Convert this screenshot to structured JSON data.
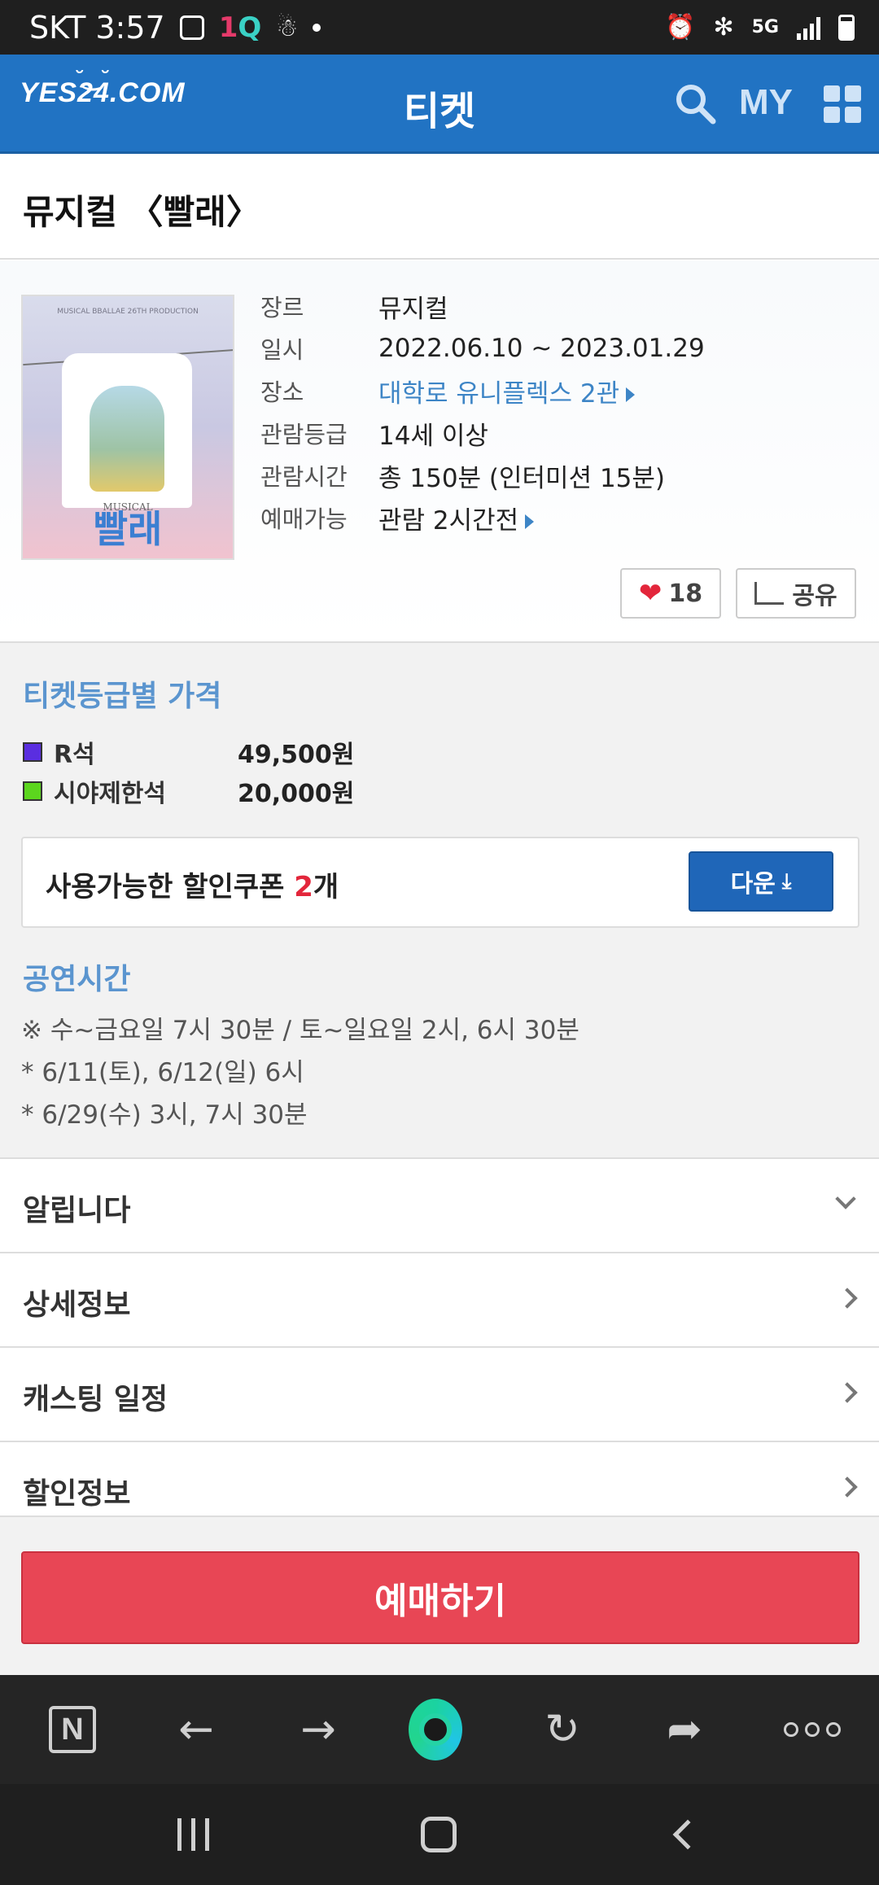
{
  "status_bar": {
    "carrier_time": "SKT 3:57",
    "app_icon_text_1": "1",
    "app_icon_text_q": "Q",
    "network": "5G"
  },
  "header": {
    "logo": "YES24.COM",
    "title": "티켓",
    "my_label": "MY"
  },
  "show": {
    "title": "뮤지컬 〈빨래〉"
  },
  "poster": {
    "top_text": "MUSICAL BBALLAE 26TH PRODUCTION",
    "sub": "MUSICAL",
    "title": "빨래"
  },
  "info": {
    "rows": [
      {
        "key": "장르",
        "value": "뮤지컬"
      },
      {
        "key": "일시",
        "value": "2022.06.10 ~ 2023.01.29"
      },
      {
        "key": "장소",
        "value": "대학로 유니플렉스 2관"
      },
      {
        "key": "관람등급",
        "value": "14세 이상"
      },
      {
        "key": "관람시간",
        "value": "총 150분 (인터미션 15분)"
      },
      {
        "key": "예매가능",
        "value": "관람 2시간전"
      }
    ]
  },
  "actions": {
    "like_count": "18",
    "share_label": "공유"
  },
  "prices": {
    "title": "티켓등급별 가격",
    "items": [
      {
        "name": "R석",
        "price": "49,500원",
        "color": "#5a2ee0"
      },
      {
        "name": "시야제한석",
        "price": "20,000원",
        "color": "#5cd61e"
      }
    ]
  },
  "coupon": {
    "text_prefix": "사용가능한 할인쿠폰 ",
    "count": "2",
    "text_suffix": "개",
    "button": "다운"
  },
  "schedule": {
    "title": "공연시간",
    "lines": [
      "※ 수~금요일 7시 30분 / 토~일요일 2시, 6시 30분",
      "* 6/11(토), 6/12(일) 6시",
      "* 6/29(수) 3시, 7시 30분"
    ]
  },
  "menu": [
    {
      "label": "알립니다"
    },
    {
      "label": "상세정보"
    },
    {
      "label": "캐스팅 일정"
    },
    {
      "label": "할인정보"
    }
  ],
  "booking": {
    "button": "예매하기"
  },
  "browser": {
    "n_label": "N"
  },
  "colors": {
    "header": "#2173c3",
    "accent_blue": "#5b95cf",
    "book": "#e84655"
  }
}
